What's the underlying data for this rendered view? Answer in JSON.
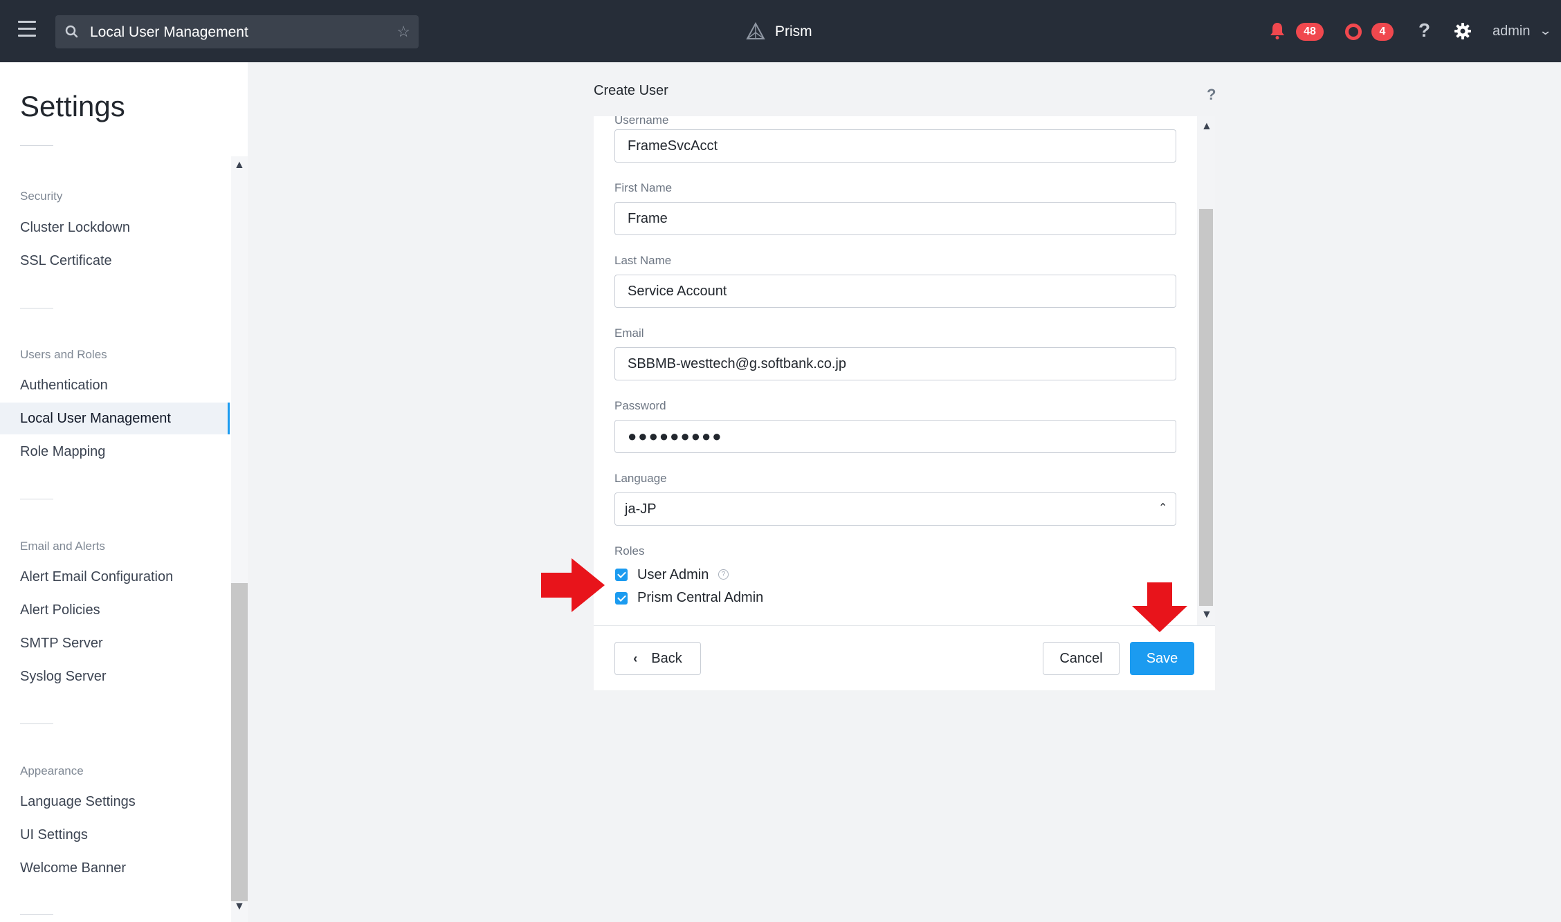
{
  "header": {
    "search_text": "Local User Management",
    "brand": "Prism",
    "alerts_count": "48",
    "events_count": "4",
    "help": "?",
    "user": "admin"
  },
  "sidebar": {
    "title": "Settings",
    "sections": [
      {
        "label": "Security",
        "items": [
          "Cluster Lockdown",
          "SSL Certificate"
        ]
      },
      {
        "label": "Users and Roles",
        "items": [
          "Authentication",
          "Local User Management",
          "Role Mapping"
        ]
      },
      {
        "label": "Email and Alerts",
        "items": [
          "Alert Email Configuration",
          "Alert Policies",
          "SMTP Server",
          "Syslog Server"
        ]
      },
      {
        "label": "Appearance",
        "items": [
          "Language Settings",
          "UI Settings",
          "Welcome Banner"
        ]
      }
    ],
    "active_item": "Local User Management"
  },
  "dialog": {
    "title": "Create User",
    "help": "?",
    "username_label": "Username",
    "username_value": "FrameSvcAcct",
    "first_name_label": "First Name",
    "first_name_value": "Frame",
    "last_name_label": "Last Name",
    "last_name_value": "Service Account",
    "email_label": "Email",
    "email_value": "SBBMB-westtech@g.softbank.co.jp",
    "password_label": "Password",
    "password_value": "●●●●●●●●●",
    "language_label": "Language",
    "language_value": "ja-JP",
    "roles_label": "Roles",
    "roles": [
      {
        "label": "User Admin",
        "checked": true
      },
      {
        "label": "Prism Central Admin",
        "checked": true
      }
    ],
    "back_label": "Back",
    "cancel_label": "Cancel",
    "save_label": "Save"
  },
  "colors": {
    "topbar": "#262d38",
    "accent": "#1b9bf0",
    "alert_red": "#f0484e",
    "annotation_red": "#e8141b"
  }
}
